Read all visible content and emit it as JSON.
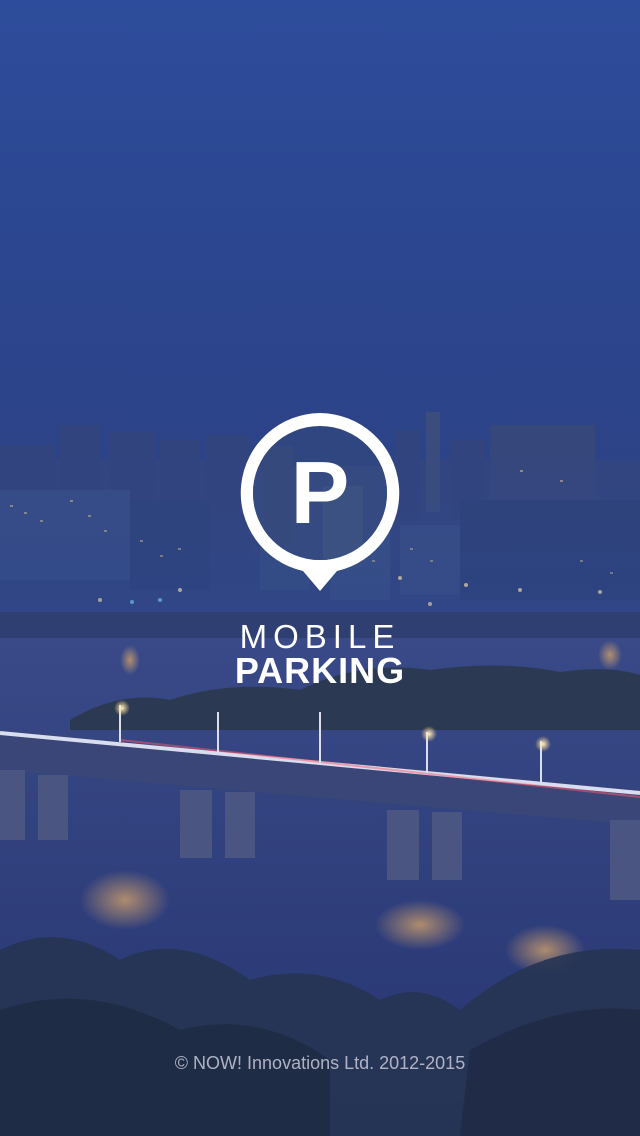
{
  "app": {
    "logo_line1": "MOBILE",
    "logo_line2": "PARKING",
    "logo_letter": "P"
  },
  "footer": {
    "copyright": "© NOW! Innovations Ltd. 2012-2015"
  },
  "colors": {
    "sky_top": "#2d4b9a",
    "sky_mid": "#2b4488",
    "water": "#2b3f80",
    "logo": "#ffffff"
  },
  "icons": {
    "logo": "parking-pin-icon"
  }
}
